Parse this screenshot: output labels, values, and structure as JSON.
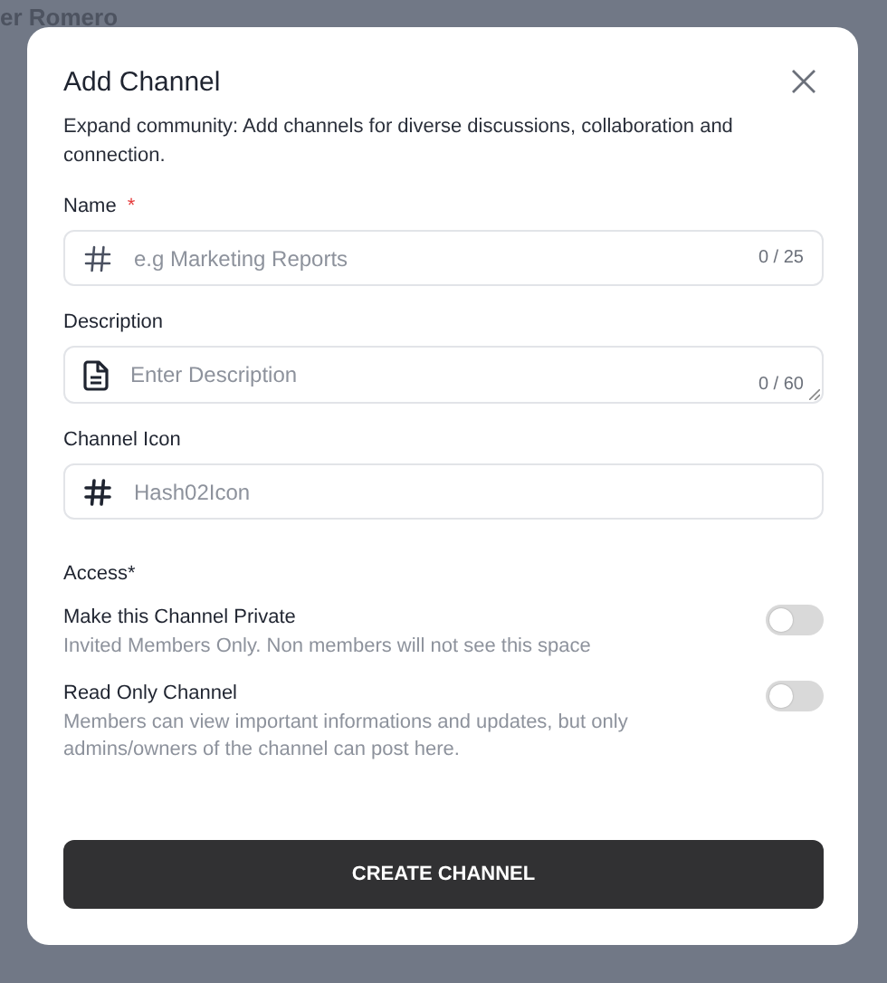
{
  "background": {
    "user_name": "er Romero"
  },
  "dialog": {
    "title": "Add Channel",
    "subtitle": "Expand community: Add channels for diverse discussions, collaboration and connection."
  },
  "fields": [
    {
      "kind": "name",
      "label": "Name",
      "required_mark": "*",
      "placeholder": "e.g Marketing Reports",
      "counter": "0 / 25"
    },
    {
      "kind": "description",
      "label": "Description",
      "placeholder": "Enter Description",
      "counter": "0 / 60"
    },
    {
      "kind": "icon",
      "label": "Channel Icon",
      "value": "Hash02Icon"
    }
  ],
  "access": {
    "label": "Access*",
    "options": [
      {
        "title": "Make this Channel Private",
        "description": "Invited Members Only. Non members will not see this space",
        "on": false
      },
      {
        "title": "Read Only Channel",
        "description": "Members can view important informations and updates, but only admins/owners of the channel can post here.",
        "on": false
      }
    ]
  },
  "submit_button": "CREATE CHANNEL"
}
